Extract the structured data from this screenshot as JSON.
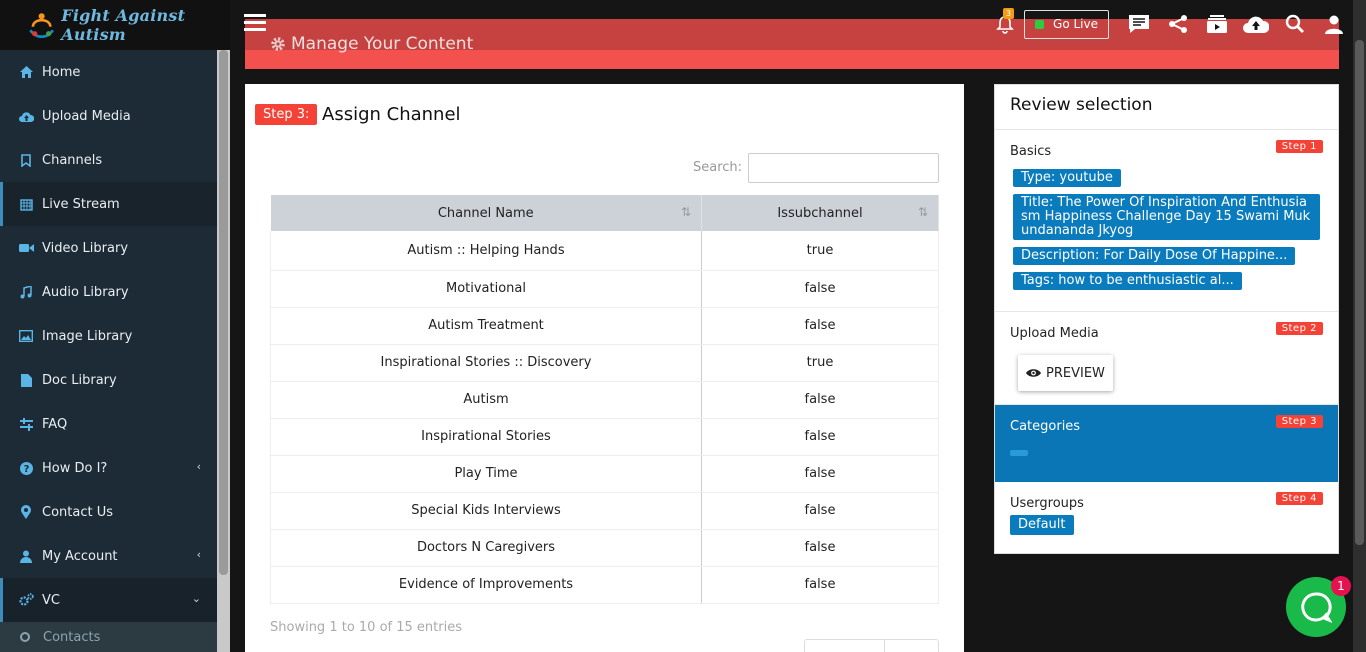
{
  "brand": {
    "name": "Fight Against Autism"
  },
  "header": {
    "notifications_count": "3",
    "go_live_label": "Go Live"
  },
  "sidebar": {
    "items": [
      {
        "label": "Home",
        "icon": "home-icon"
      },
      {
        "label": "Upload Media",
        "icon": "cloud-upload-icon"
      },
      {
        "label": "Channels",
        "icon": "bookmark-icon"
      },
      {
        "label": "Live Stream",
        "icon": "calendar-icon"
      },
      {
        "label": "Video Library",
        "icon": "video-camera-icon"
      },
      {
        "label": "Audio Library",
        "icon": "music-icon"
      },
      {
        "label": "Image Library",
        "icon": "image-icon"
      },
      {
        "label": "Doc Library",
        "icon": "document-icon"
      },
      {
        "label": "FAQ",
        "icon": "sliders-icon"
      },
      {
        "label": "How Do I?",
        "icon": "question-icon"
      },
      {
        "label": "Contact Us",
        "icon": "map-marker-icon"
      },
      {
        "label": "My Account",
        "icon": "user-icon"
      },
      {
        "label": "VC",
        "icon": "cogs-icon"
      }
    ],
    "sub_items": [
      {
        "label": "Contacts"
      }
    ]
  },
  "page": {
    "title": "Manage Your Content"
  },
  "assign": {
    "step_label": "Step 3:",
    "title": "Assign Channel",
    "search_label": "Search:",
    "columns": [
      "Channel Name",
      "Issubchannel"
    ],
    "rows": [
      {
        "name": "Autism :: Helping Hands",
        "sub": "true"
      },
      {
        "name": "Motivational",
        "sub": "false"
      },
      {
        "name": "Autism Treatment",
        "sub": "false"
      },
      {
        "name": "Inspirational Stories :: Discovery",
        "sub": "true"
      },
      {
        "name": "Autism",
        "sub": "false"
      },
      {
        "name": "Inspirational Stories",
        "sub": "false"
      },
      {
        "name": "Play Time",
        "sub": "false"
      },
      {
        "name": "Special Kids Interviews",
        "sub": "false"
      },
      {
        "name": "Doctors N Caregivers",
        "sub": "false"
      },
      {
        "name": "Evidence of Improvements",
        "sub": "false"
      }
    ],
    "info": "Showing 1 to 10 of 15 entries"
  },
  "review": {
    "title": "Review selection",
    "basics": {
      "label": "Basics",
      "step": "Step 1",
      "type": "Type: youtube",
      "title": "Title: The Power Of Inspiration And Enthusiasm Happiness Challenge Day 15 Swami Mukundananda Jkyog",
      "description": "Description: For Daily Dose Of Happine...",
      "tags": "Tags: how to be enthusiastic al..."
    },
    "upload": {
      "label": "Upload Media",
      "step": "Step 2",
      "preview": "PREVIEW"
    },
    "categories": {
      "label": "Categories",
      "step": "Step 3"
    },
    "usergroups": {
      "label": "Usergroups",
      "step": "Step 4",
      "chip": "Default"
    }
  },
  "chat": {
    "badge": "1"
  },
  "colors": {
    "accent": "#f44336",
    "primary": "#0a76b5",
    "sidebar": "#1c2b36"
  }
}
